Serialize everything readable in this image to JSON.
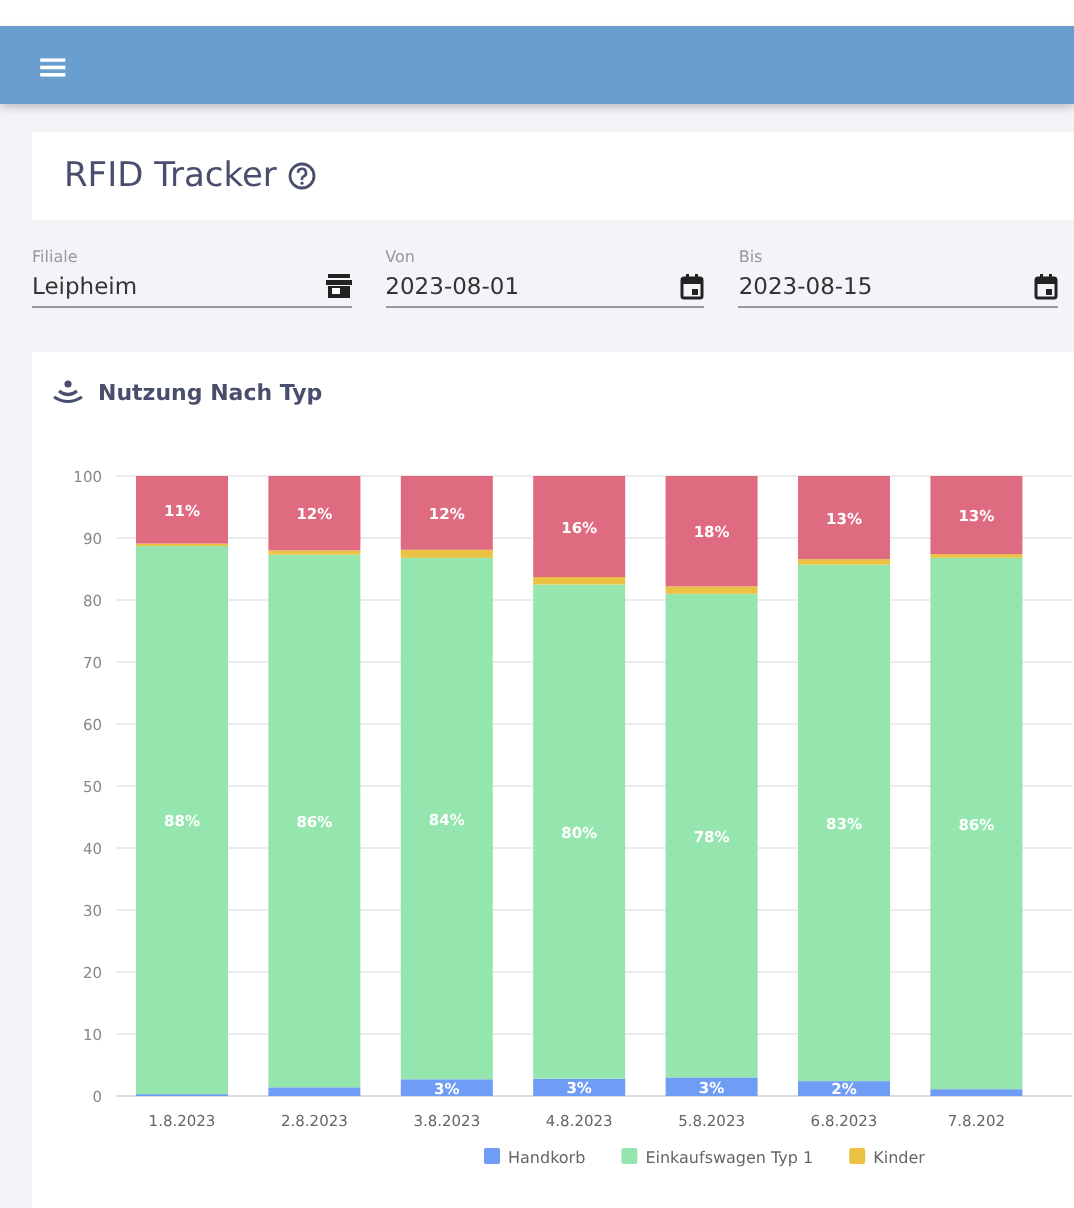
{
  "header": {
    "menu_icon": "≡"
  },
  "title_card": {
    "title": "RFID Tracker"
  },
  "filters": [
    {
      "label": "Filiale",
      "value": "Leipheim",
      "kind": "store"
    },
    {
      "label": "Von",
      "value": "2023-08-01",
      "kind": "date"
    },
    {
      "label": "Bis",
      "value": "2023-08-15",
      "kind": "date"
    }
  ],
  "chart_card": {
    "title": "Nutzung Nach Typ",
    "chart_data": {
      "type": "bar",
      "stacked": true,
      "orientation": "vertical",
      "categories": [
        "1.8.2023",
        "2.8.2023",
        "3.8.2023",
        "4.8.2023",
        "5.8.2023",
        "6.8.2023",
        "7.8.202"
      ],
      "grid": true,
      "legend": true,
      "ylim": [
        0,
        100
      ],
      "yticks": [
        0,
        10,
        20,
        30,
        40,
        50,
        60,
        70,
        80,
        90,
        100
      ],
      "series": [
        {
          "name": "Handkorb",
          "color": "#6f9cf4",
          "values": [
            0.3,
            1.4,
            2.7,
            2.8,
            3.0,
            2.4,
            1.1
          ],
          "value_labels": [
            null,
            null,
            "3%",
            "3%",
            "3%",
            "2%",
            null
          ]
        },
        {
          "name": "Einkaufswagen Typ 1",
          "color": "#95e6ae",
          "values": [
            88.4,
            85.9,
            84.1,
            79.7,
            78.0,
            83.3,
            85.7
          ],
          "value_labels": [
            "88%",
            "86%",
            "84%",
            "80%",
            "78%",
            "83%",
            "86%"
          ]
        },
        {
          "name": "Kinder",
          "color": "#ecc245",
          "values": [
            0.4,
            0.7,
            1.3,
            1.2,
            1.2,
            0.9,
            0.6
          ],
          "value_labels": [
            null,
            null,
            null,
            null,
            null,
            null,
            null
          ]
        },
        {
          "color": "#df6b80",
          "values": [
            10.9,
            12.0,
            11.9,
            16.3,
            17.8,
            13.4,
            12.6
          ],
          "value_labels": [
            "11%",
            "12%",
            "12%",
            "16%",
            "18%",
            "13%",
            "13%"
          ]
        }
      ]
    }
  }
}
